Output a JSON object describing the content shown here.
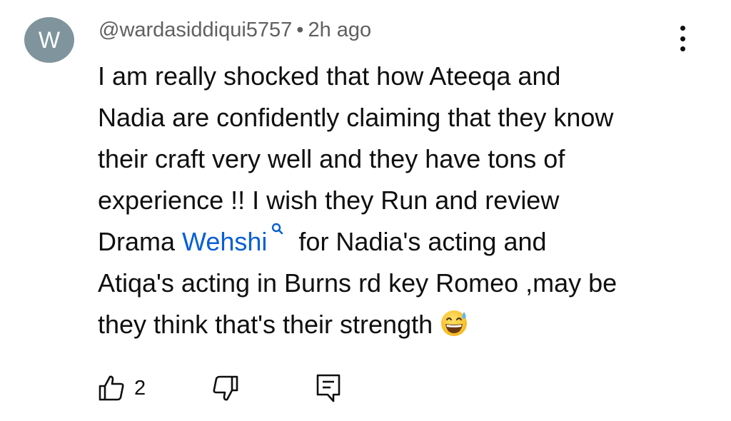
{
  "comment": {
    "avatar_letter": "W",
    "author": "@wardasiddiqui5757",
    "separator": "•",
    "time": "2h ago",
    "text_lines": [
      "I am really shocked that how Ateeqa and",
      "Nadia are confidently claiming that they know",
      "their craft very well and they have tons of",
      "experience !! I wish they Run and review"
    ],
    "line5_prefix": "Drama ",
    "line5_link": "Wehshi",
    "line5_suffix": "for Nadia's acting and",
    "line6": "Atiqa's acting in Burns rd key Romeo ,may be",
    "line7": "they think that's their strength",
    "like_count": "2"
  },
  "colors": {
    "avatar_bg": "#7f949c",
    "link": "#065fd4",
    "meta_text": "#606060",
    "text": "#0f0f0f"
  },
  "icons": {
    "avatar": "letter-avatar",
    "more": "vertical-ellipsis-icon",
    "link_search": "search-icon",
    "emoji": "grinning-face-with-sweat-emoji",
    "like": "thumbs-up-icon",
    "dislike": "thumbs-down-icon",
    "reply": "reply-comment-icon"
  }
}
